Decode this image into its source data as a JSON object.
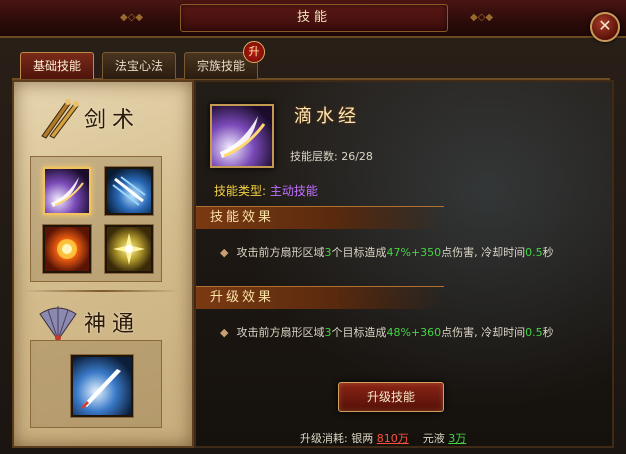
{
  "window": {
    "title": "技能"
  },
  "tabs": [
    {
      "label": "基础技能",
      "active": true
    },
    {
      "label": "法宝心法",
      "active": false
    },
    {
      "label": "宗族技能",
      "active": false,
      "badge": "升"
    }
  ],
  "left": {
    "section1_title": "剑术",
    "section2_title": "神通",
    "skills": [
      {
        "icon": "sword-slash-icon",
        "selected": true
      },
      {
        "icon": "ice-slash-icon",
        "selected": false
      },
      {
        "icon": "fire-burst-icon",
        "selected": false
      },
      {
        "icon": "golden-flare-icon",
        "selected": false
      }
    ],
    "divine": [
      {
        "icon": "flying-sword-icon"
      }
    ]
  },
  "detail": {
    "skill_name": "滴水经",
    "level_label": "技能层数: 26/28",
    "type_label": "技能类型:",
    "type_value": "主动技能",
    "effect_header": "技能效果",
    "effect": {
      "pre": "攻击前方扇形区域",
      "targets": "3",
      "mid": "个目标造成",
      "pct": "47%",
      "plus": "+350",
      "post": "点伤害, 冷却时间",
      "cooldown": "0.5",
      "unit": "秒"
    },
    "upgrade_header": "升级效果",
    "upgrade_effect": {
      "pre": "攻击前方扇形区域",
      "targets": "3",
      "mid": "个目标造成",
      "pct": "48%",
      "plus": "+360",
      "post": "点伤害, 冷却时间",
      "cooldown": "0.5",
      "unit": "秒"
    },
    "upgrade_button": "升级技能",
    "cost": {
      "label": "升级消耗: 银两",
      "silver": "810万",
      "yuanye_label": "元液",
      "yuanye": "3万"
    }
  },
  "colors": {
    "title_bar": "#4a1412",
    "parchment": "#d4bd8e",
    "accent_gold": "#c49a52",
    "type_purple": "#c070ff",
    "effect_green": "#44d444",
    "cost_red": "#ff5040"
  }
}
